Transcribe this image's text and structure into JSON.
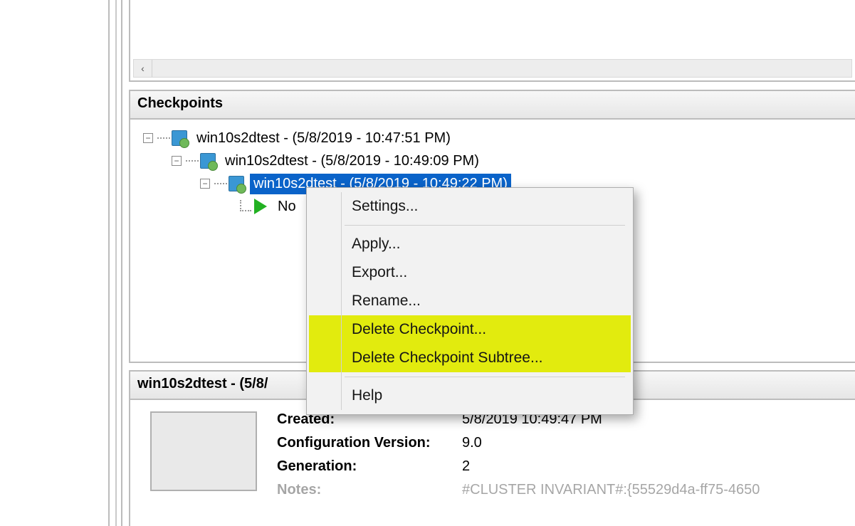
{
  "panels": {
    "checkpoints_title": "Checkpoints",
    "details_title_partial": "win10s2dtest - (5/8/"
  },
  "tree": {
    "row0": {
      "label": "win10s2dtest - (5/8/2019 - 10:47:51 PM)"
    },
    "row1": {
      "label": "win10s2dtest - (5/8/2019 - 10:49:09 PM)"
    },
    "row2": {
      "label_full": "win10s2dtest - (5/8/2019 - 10:49:22 PM)",
      "label_visible": "win10s2dtest - (5/8/2019 - 10:49:22 PM)"
    },
    "row3": {
      "label_visible": "No"
    }
  },
  "context_menu": {
    "settings": "Settings...",
    "apply": "Apply...",
    "export": "Export...",
    "rename": "Rename...",
    "delete_checkpoint": "Delete Checkpoint...",
    "delete_subtree": "Delete Checkpoint Subtree...",
    "help": "Help"
  },
  "details": {
    "created_label": "Created:",
    "created_value": "5/8/2019 10:49:47 PM",
    "config_label": "Configuration Version:",
    "config_value": "9.0",
    "generation_label": "Generation:",
    "generation_value": "2",
    "notes_label": "Notes:",
    "notes_value": "#CLUSTER INVARIANT#:{55529d4a-ff75-4650"
  },
  "scrollbar": {
    "left_arrow": "‹"
  }
}
